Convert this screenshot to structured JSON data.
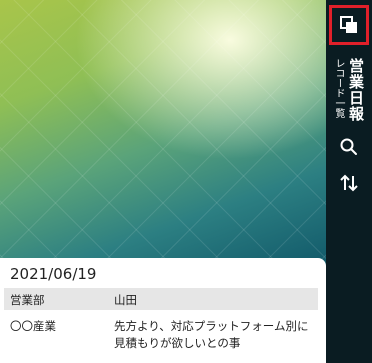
{
  "sidebar": {
    "title": "営業日報",
    "subtitle": "レコード一覧",
    "buttons": [
      {
        "icon": "window-switch-icon"
      },
      {
        "icon": "search-icon"
      },
      {
        "icon": "sort-icon"
      }
    ],
    "highlight_color": "#e0202a"
  },
  "record": {
    "date": "2021/06/19",
    "header": {
      "col1": "営業部",
      "col2": "山田"
    },
    "row": {
      "col1": "〇〇産業",
      "col2": "先方より、対応プラットフォーム別に見積もりが欲しいとの事"
    }
  }
}
